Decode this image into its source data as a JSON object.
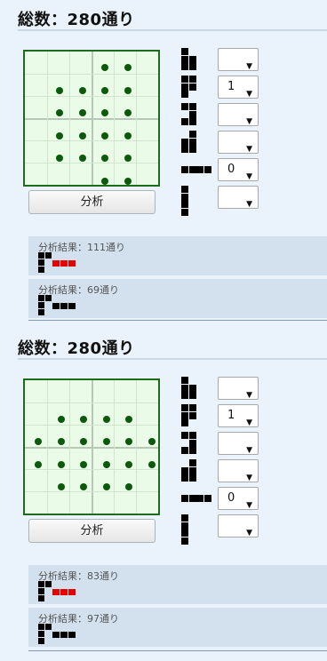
{
  "sections": [
    {
      "title": "総数：280通り",
      "analyze_label": "分析",
      "selects": [
        "",
        "1",
        "",
        "",
        "0",
        ""
      ],
      "results": [
        {
          "label": "分析結果：111通り",
          "highlight": "red"
        },
        {
          "label": "分析結果：69通り",
          "highlight": "black"
        }
      ]
    },
    {
      "title": "総数：280通り",
      "analyze_label": "分析",
      "selects": [
        "",
        "1",
        "",
        "",
        "0",
        ""
      ],
      "results": [
        {
          "label": "分析結果：83通り",
          "highlight": "red"
        },
        {
          "label": "分析結果：97通り",
          "highlight": "black"
        }
      ]
    }
  ],
  "colors": {
    "board_border": "#1d6b1d",
    "board_bg": "#eafbe8",
    "dot": "#0b5a0b",
    "result_bg": "#d3e1ee",
    "highlight_red": "#e60000"
  },
  "icons": [
    "tromino-piece-icon",
    "bar-piece-icon",
    "dropdown-arrow-icon"
  ]
}
